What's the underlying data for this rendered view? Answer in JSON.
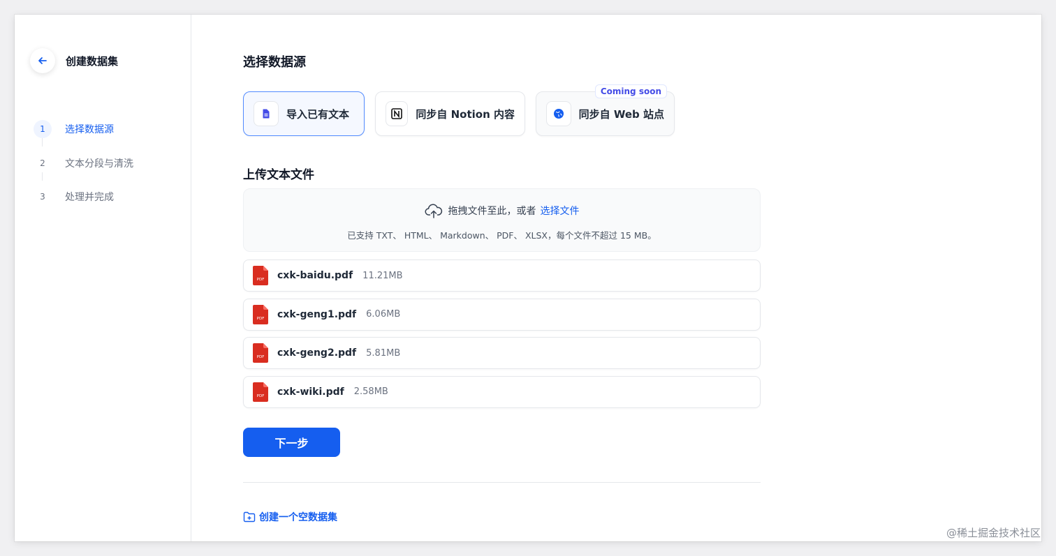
{
  "sidebar": {
    "back_title": "创建数据集",
    "steps": [
      {
        "num": "1",
        "label": "选择数据源"
      },
      {
        "num": "2",
        "label": "文本分段与清洗"
      },
      {
        "num": "3",
        "label": "处理并完成"
      }
    ]
  },
  "main": {
    "title": "选择数据源",
    "sources": [
      {
        "label": "导入已有文本",
        "icon": "file-text-icon"
      },
      {
        "label": "同步自 Notion 内容",
        "icon": "notion-icon"
      },
      {
        "label": "同步自 Web 站点",
        "icon": "globe-icon",
        "badge": "Coming soon"
      }
    ],
    "upload_title": "上传文本文件",
    "dropzone": {
      "text": "拖拽文件至此，或者",
      "link": "选择文件",
      "hint": "已支持 TXT、 HTML、 Markdown、 PDF、 XLSX，每个文件不超过 15 MB。"
    },
    "files": [
      {
        "name": "cxk-baidu.pdf",
        "size": "11.21MB"
      },
      {
        "name": "cxk-geng1.pdf",
        "size": "6.06MB"
      },
      {
        "name": "cxk-geng2.pdf",
        "size": "5.81MB"
      },
      {
        "name": "cxk-wiki.pdf",
        "size": "2.58MB"
      }
    ],
    "next_label": "下一步",
    "empty_dataset_label": "创建一个空数据集"
  },
  "watermark": "@稀土掘金技术社区",
  "colors": {
    "accent": "#155eef",
    "pdf_red": "#d92d20"
  }
}
